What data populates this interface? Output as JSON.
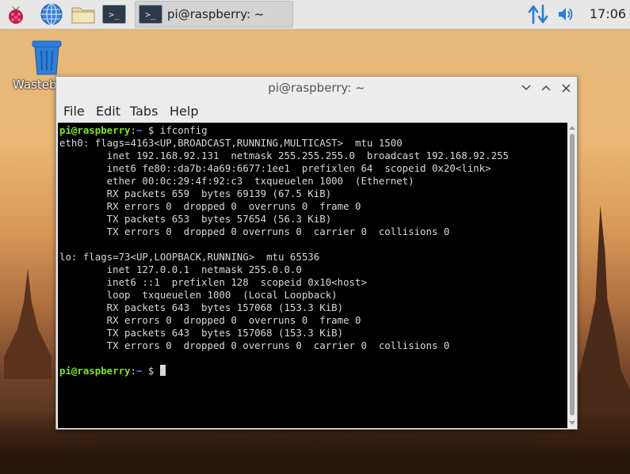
{
  "taskbar": {
    "launchers": [
      {
        "name": "raspberry-menu",
        "icon": "raspberry-icon"
      },
      {
        "name": "web-browser",
        "icon": "globe-icon"
      },
      {
        "name": "file-manager",
        "icon": "folder-icon"
      },
      {
        "name": "terminal",
        "icon": "terminal-icon",
        "glyph": ">_"
      }
    ],
    "task": {
      "label": "pi@raspberry: ~",
      "glyph": ">_"
    },
    "tray": {
      "network_icon": "network-updown-icon",
      "volume_icon": "speaker-icon"
    },
    "clock": "17:06"
  },
  "desktop": {
    "trash_label": "Wasteb"
  },
  "window": {
    "title": "pi@raspberry: ~",
    "controls": {
      "minimize": "﹀",
      "maximize": "︿",
      "close": "✕"
    },
    "menu": [
      "File",
      "Edit",
      "Tabs",
      "Help"
    ]
  },
  "terminal": {
    "prompt": {
      "user": "pi@raspberry",
      "sep": ":",
      "path": "~",
      "symbol": " $ "
    },
    "command": "ifconfig",
    "output": [
      "eth0: flags=4163<UP,BROADCAST,RUNNING,MULTICAST>  mtu 1500",
      "        inet 192.168.92.131  netmask 255.255.255.0  broadcast 192.168.92.255",
      "        inet6 fe80::da7b:4a69:6677:1ee1  prefixlen 64  scopeid 0x20<link>",
      "        ether 00:0c:29:4f:92:c3  txqueuelen 1000  (Ethernet)",
      "        RX packets 659  bytes 69139 (67.5 KiB)",
      "        RX errors 0  dropped 0  overruns 0  frame 0",
      "        TX packets 653  bytes 57654 (56.3 KiB)",
      "        TX errors 0  dropped 0 overruns 0  carrier 0  collisions 0",
      "",
      "lo: flags=73<UP,LOOPBACK,RUNNING>  mtu 65536",
      "        inet 127.0.0.1  netmask 255.0.0.0",
      "        inet6 ::1  prefixlen 128  scopeid 0x10<host>",
      "        loop  txqueuelen 1000  (Local Loopback)",
      "        RX packets 643  bytes 157068 (153.3 KiB)",
      "        RX errors 0  dropped 0  overruns 0  frame 0",
      "        TX packets 643  bytes 157068 (153.3 KiB)",
      "        TX errors 0  dropped 0 overruns 0  carrier 0  collisions 0",
      ""
    ]
  },
  "colors": {
    "prompt_user": "#7fe12d",
    "prompt_path": "#6f8cff",
    "terminal_bg": "#000000",
    "terminal_fg": "#d8d8d8"
  }
}
